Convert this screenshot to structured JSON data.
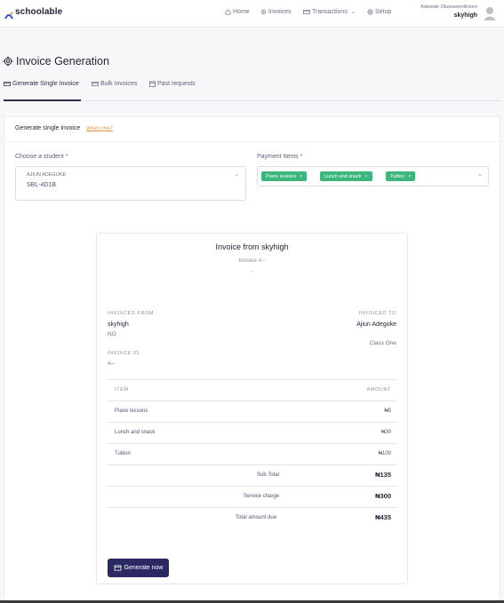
{
  "app": {
    "logo_text": "schoolable"
  },
  "nav": {
    "home": "Home",
    "invoices": "Invoices",
    "transactions": "Transactions",
    "setup": "Setup",
    "user_name": "Adewale Oluwasemilroore",
    "school": "skyhigh"
  },
  "page": {
    "title": "Invoice Generation"
  },
  "tabs": [
    {
      "label": "Generate Single Invoice",
      "active": true
    },
    {
      "label": "Bulk Invoices",
      "active": false
    },
    {
      "label": "Past requests",
      "active": false
    }
  ],
  "form": {
    "card_title": "Generate single invoice",
    "whats_this": "What's this?",
    "student_label": "Choose a student",
    "student_required": "*",
    "student_name": "AJIUN ADEGOKE",
    "student_id": "SBL-4D1B",
    "items_label": "Payment Items",
    "items_required": "*",
    "payment_items": [
      "Piano lessons",
      "Lunch and snack",
      "Tuition"
    ]
  },
  "invoice": {
    "title": "Invoice from skyhigh",
    "invoice_no": "Invoice #--",
    "dash": "-",
    "from_label": "INVOICED FROM",
    "from_name": "skyhigh",
    "from_country": "NG",
    "to_label": "INVOICED TO",
    "to_name": "Ajiun Adegoke",
    "to_class": "Class One",
    "id_label": "INVOICE ID",
    "id_value": "#--",
    "col_item": "ITEM",
    "col_amount": "AMOUNT",
    "rows": [
      {
        "item": "Piano lessons",
        "amount": "₦5"
      },
      {
        "item": "Lunch and snack",
        "amount": "₦30"
      },
      {
        "item": "Tuition",
        "amount": "₦100"
      }
    ],
    "subtotal_label": "Sub Total",
    "subtotal": "₦135",
    "service_label": "Service charge",
    "service": "₦300",
    "total_label": "Total amount due",
    "total": "₦435",
    "generate_label": "Generate now"
  },
  "colors": {
    "accent": "#2b2963",
    "chip": "#3cb67a",
    "link": "#e8923a"
  }
}
